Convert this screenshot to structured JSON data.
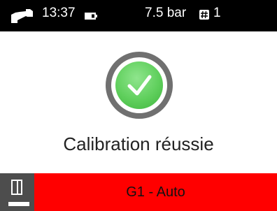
{
  "status_bar": {
    "device_icon": "gas-detector-icon",
    "time": "13:37",
    "battery_icon": "battery-icon",
    "pressure": "7.5 bar",
    "hash_icon": "hash-badge-icon",
    "count": "1"
  },
  "main": {
    "status_icon": "check-circle-icon",
    "message": "Calibration réussie"
  },
  "bottom_bar": {
    "mode_icon": "door-panel-icon",
    "gas_mode": "G1 - Auto"
  },
  "colors": {
    "status_bar_bg": "#000000",
    "success_green": "#5fcf5c",
    "ring_gray": "#707070",
    "mode_bar_red": "#ff0000",
    "mode_button_gray": "#4d4d4d"
  }
}
